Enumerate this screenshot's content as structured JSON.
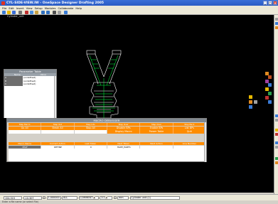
{
  "window": {
    "title": "CYL-SIDE-VIEW.IW - OneSpace Designer Drafting 2005",
    "controls": [
      "_",
      "□",
      "×"
    ]
  },
  "menu": [
    "File",
    "Edit",
    "Insert",
    "View",
    "Setup",
    "Modules",
    "Collaborate",
    "Help"
  ],
  "toolbar": {
    "icons": [
      "new-file-icon",
      "open-folder-icon",
      "save-icon",
      "print-icon",
      "cut-icon",
      "copy-icon",
      "paste-icon",
      "undo-icon",
      "redo-icon",
      "grid-icon",
      "layers-icon",
      "info-icon"
    ],
    "colors": [
      "#3a7bd5",
      "#e6b800",
      "#3a6fd8",
      "#707070",
      "#c03030",
      "#4a8fe0",
      "#c8a040",
      "#3070c0",
      "#3070c0",
      "#505050",
      "#a0a0a0",
      "#3a7bd5"
    ]
  },
  "view_label": "Cylinder_unit",
  "parameter_table": {
    "title": "Parameter Table",
    "columns": [
      "Name",
      "Value"
    ],
    "rows": [
      {
        "name": "A",
        "value": "(undefined)"
      },
      {
        "name": "B",
        "value": "(undefined)"
      },
      {
        "name": "C",
        "value": "(undefined)"
      }
    ]
  },
  "macro_debugger": {
    "title": "MACRO DEBUGGER",
    "control_headers": [
      "Step Macro",
      "Step Out",
      "Step Into",
      "Step Over",
      "Step Over",
      "Step Back"
    ],
    "control_buttons": [
      "Go All",
      "Break All",
      "Stop All",
      "Disable BPs",
      "Enable BPs",
      "List BPs"
    ],
    "control_buttons_2": [
      "Display Macro",
      "Param Table",
      "Quit"
    ],
    "columns": [
      "Macro Name",
      "Current Action",
      "Last Token",
      "Next Token",
      "Next Action",
      "Line Number"
    ],
    "row": [
      "PPAF",
      "DEFINE",
      "0",
      "HAPP_PARTS",
      "",
      ""
    ]
  },
  "status": {
    "x_coord": "154.315",
    "y_coord": "-10.307",
    "scale": "1.000000",
    "layer": "ALL",
    "color": "COMMENT",
    "ratio": "1:1",
    "units": "mm",
    "workplane": "Cylinder unit (1)",
    "message": "Enter a file name (or select File)"
  },
  "colors": {
    "accent_orange": "#ff8c00",
    "drawing_white": "#ffffff",
    "drawing_green": "#00ff40",
    "canvas_bg": "#000000"
  }
}
